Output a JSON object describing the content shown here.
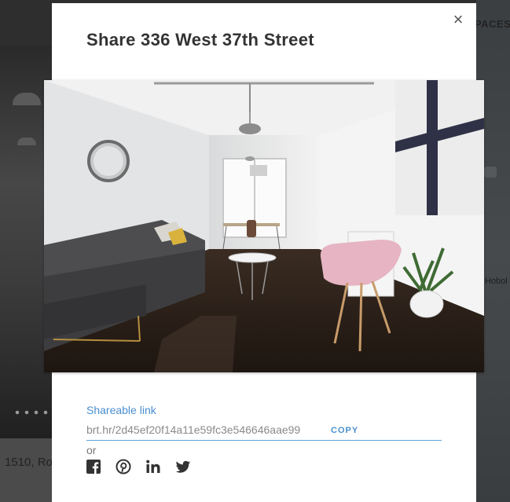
{
  "background": {
    "address_fragment": "1510, Ro",
    "header_fragment": "PACES",
    "map_label": "Hobol"
  },
  "modal": {
    "title": "Share 336 West 37th Street",
    "close_label": "×",
    "photo_alt": "336 West 37th Street",
    "shareable_link_label": "Shareable link",
    "shareable_url": "brt.hr/2d45ef20f14a11e59fc3e546646aae99",
    "copy_label": "COPY",
    "or_label": "or"
  },
  "social": [
    {
      "name": "facebook-icon",
      "label": "Facebook"
    },
    {
      "name": "pinterest-icon",
      "label": "Pinterest"
    },
    {
      "name": "linkedin-icon",
      "label": "LinkedIn"
    },
    {
      "name": "twitter-icon",
      "label": "Twitter"
    }
  ],
  "colors": {
    "accent": "#4a8fcf",
    "title": "#333333",
    "icon": "#333333"
  }
}
